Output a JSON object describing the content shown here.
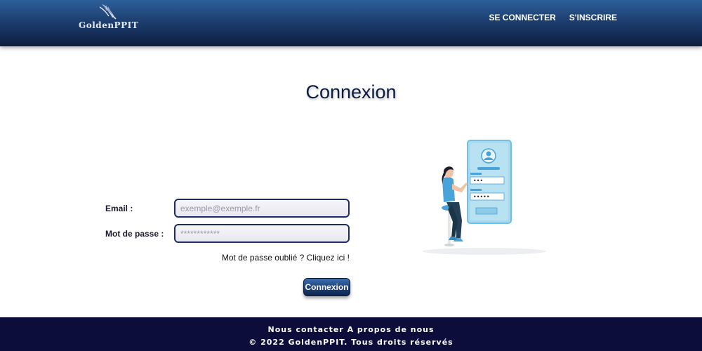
{
  "header": {
    "logo_text": "GoldenPPIT",
    "nav": [
      {
        "label": "SE CONNECTER"
      },
      {
        "label": "S'INSCRIRE"
      }
    ]
  },
  "main": {
    "title": "Connexion",
    "form": {
      "email_label": "Email :",
      "email_placeholder": "exemple@exemple.fr",
      "password_label": "Mot de passe :",
      "password_placeholder": "************",
      "forgot_text": "Mot de passe oublié ? Cliquez ici !",
      "submit_label": "Connexion"
    },
    "illustration": {
      "password_dots_1": "•••",
      "password_dots_2": "•••••"
    }
  },
  "footer": {
    "links": [
      {
        "label": "Nous contacter"
      },
      {
        "label": "A propos de nous"
      }
    ],
    "copyright": "© 2022 GoldenPPIT. Tous droits réservés"
  },
  "colors": {
    "header_top": "#2c5f9a",
    "header_bottom": "#0d1d40",
    "input_border": "#1e2c5e",
    "footer_bg": "#0c0d3a",
    "title_color": "#0f1b40",
    "illustration_accent": "#4aa3d8"
  },
  "icons": {
    "logo": "quill-feather-icon"
  }
}
